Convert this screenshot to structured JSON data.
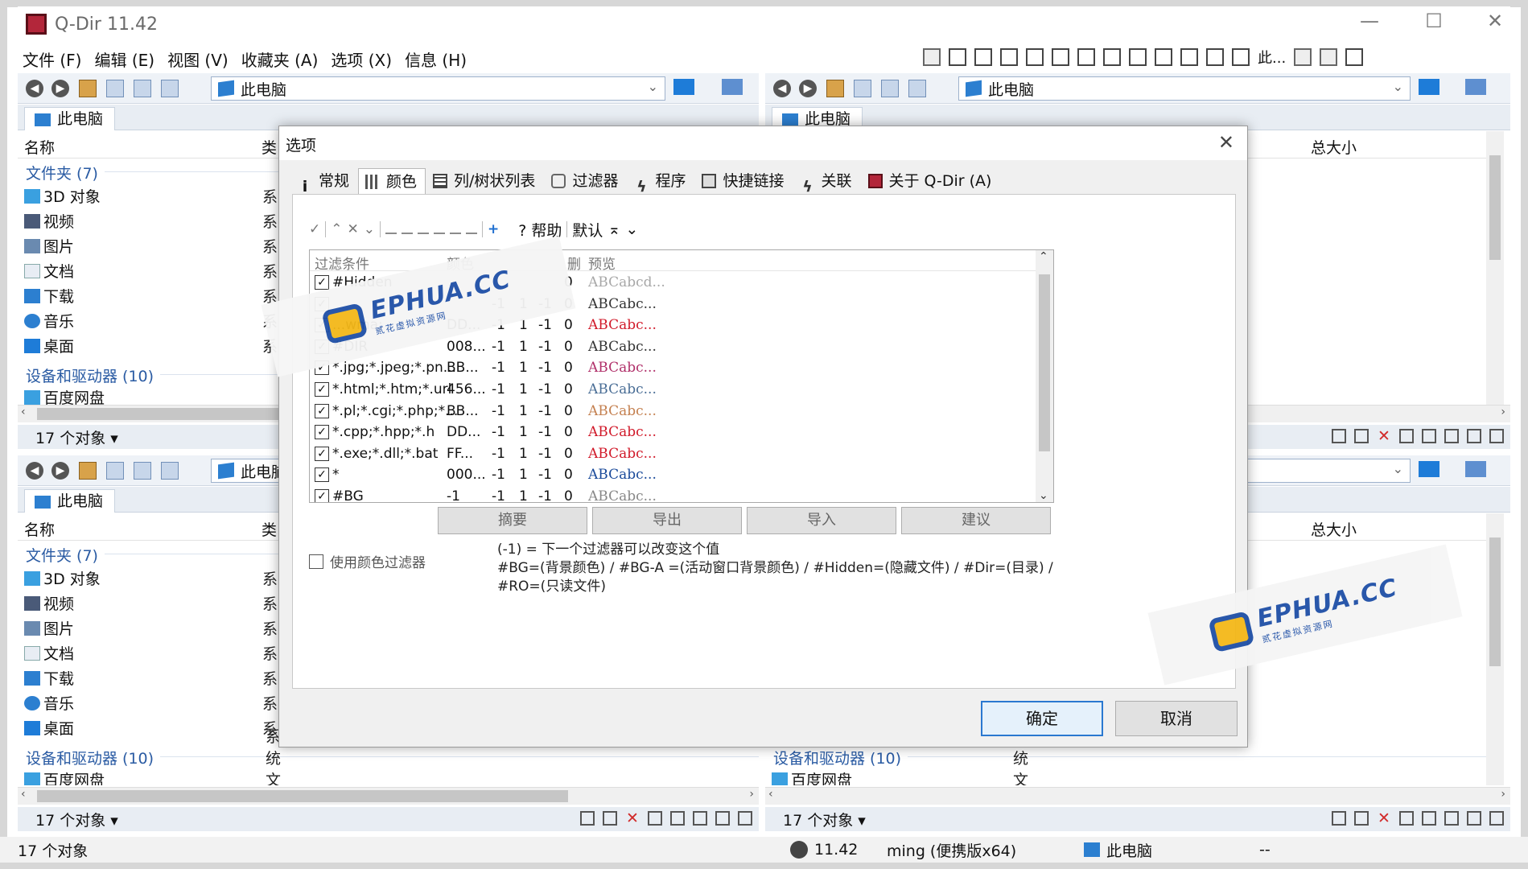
{
  "app": {
    "title": "Q-Dir 11.42",
    "window_controls": [
      "—",
      "☐",
      "✕"
    ]
  },
  "menu": [
    "文件 (F)",
    "编辑 (E)",
    "视图 (V)",
    "收藏夹 (A)",
    "选项 (X)",
    "信息 (H)"
  ],
  "toolbar": {
    "this_pc_short": "此..."
  },
  "panes": {
    "address": "此电脑",
    "tab": "此电脑",
    "col_name": "名称",
    "col_type": "类",
    "col_total": "总大小",
    "group_folders": "文件夹 (7)",
    "group_drives": "设备和驱动器 (10)",
    "items": [
      {
        "name": "3D 对象",
        "type": "系"
      },
      {
        "name": "视频",
        "type": "系"
      },
      {
        "name": "图片",
        "type": "系"
      },
      {
        "name": "文档",
        "type": "系"
      },
      {
        "name": "下载",
        "type": "系"
      },
      {
        "name": "音乐",
        "type": "系"
      },
      {
        "name": "桌面",
        "type": "系"
      }
    ],
    "drive_partial": "百度网盘",
    "drive_partial_type": "系统文件夹",
    "status": "17 个对象 ▾"
  },
  "bottom_status": {
    "count": "17 个对象",
    "version": "11.42",
    "user": "ming (便携版x64)",
    "location": "此电脑",
    "extra": "--"
  },
  "dialog": {
    "title": "选项",
    "close": "✕",
    "tabs": [
      "常规",
      "颜色",
      "列/树状列表",
      "过滤器",
      "程序",
      "快捷链接",
      "关联",
      "关于 Q-Dir (A)"
    ],
    "minitoolbar": {
      "help": "? 帮助",
      "default": "默认",
      "plus": "+"
    },
    "list_headers": {
      "filter": "过滤条件",
      "color": "颜色",
      "del": "删",
      "preview": "预览"
    },
    "rows": [
      {
        "filter": "#Hidden",
        "color": "",
        "a": "",
        "b": "",
        "c": "",
        "d": "0",
        "preview": "ABCabcd...",
        "pcolor": "#a8a8a8"
      },
      {
        "filter": "",
        "color": "",
        "a": "-1",
        "b": "1",
        "c": "-1",
        "d": "0",
        "preview": "ABCabc...",
        "pcolor": "#333333"
      },
      {
        "filter": "...wma;",
        "color": "DD...",
        "a": "-1",
        "b": "1",
        "c": "-1",
        "d": "0",
        "preview": "ABCabc...",
        "pcolor": "#d11a2a"
      },
      {
        "filter": "#DIR",
        "color": "008...",
        "a": "-1",
        "b": "1",
        "c": "-1",
        "d": "0",
        "preview": "ABCabc...",
        "pcolor": "#333333"
      },
      {
        "filter": "*.jpg;*.jpeg;*.pn...",
        "color": "BB...",
        "a": "-1",
        "b": "1",
        "c": "-1",
        "d": "0",
        "preview": "ABCabc...",
        "pcolor": "#b0306a"
      },
      {
        "filter": "*.html;*.htm;*.url",
        "color": "456...",
        "a": "-1",
        "b": "1",
        "c": "-1",
        "d": "0",
        "preview": "ABCabc...",
        "pcolor": "#4a6e96"
      },
      {
        "filter": "*.pl;*.cgi;*.php;*...",
        "color": "BB...",
        "a": "-1",
        "b": "1",
        "c": "-1",
        "d": "0",
        "preview": "ABCabc...",
        "pcolor": "#c48050"
      },
      {
        "filter": "*.cpp;*.hpp;*.h",
        "color": "DD...",
        "a": "-1",
        "b": "1",
        "c": "-1",
        "d": "0",
        "preview": "ABCabc...",
        "pcolor": "#d11a2a"
      },
      {
        "filter": "*.exe;*.dll;*.bat",
        "color": "FF...",
        "a": "-1",
        "b": "1",
        "c": "-1",
        "d": "0",
        "preview": "ABCabc...",
        "pcolor": "#d11a2a"
      },
      {
        "filter": "*",
        "color": "000...",
        "a": "-1",
        "b": "1",
        "c": "-1",
        "d": "0",
        "preview": "ABCabc...",
        "pcolor": "#1a4a9a"
      },
      {
        "filter": "#BG",
        "color": "-1",
        "a": "-1",
        "b": "1",
        "c": "-1",
        "d": "0",
        "preview": "ABCabc...",
        "pcolor": "#888888"
      }
    ],
    "buttons": [
      "摘要",
      "导出",
      "导入",
      "建议"
    ],
    "use_color_filter": "使用颜色过滤器",
    "notes": [
      "(-1) = 下一个过滤器可以改变这个值",
      "#BG=(背景颜色) / #BG-A =(活动窗口背景颜色) / #Hidden=(隐藏文件) / #Dir=(目录) /",
      "#RO=(只读文件)"
    ],
    "ok": "确定",
    "cancel": "取消"
  },
  "watermark": {
    "brand": "EPHUA.CC",
    "sub": "贰花虚拟资源网"
  }
}
